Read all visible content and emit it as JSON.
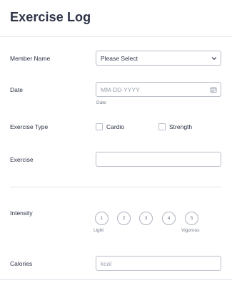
{
  "form": {
    "title": "Exercise Log"
  },
  "fields": {
    "member_name": {
      "label": "Member Name",
      "selected": "Please Select"
    },
    "date": {
      "label": "Date",
      "placeholder": "MM-DD-YYYY",
      "sublabel": "Date"
    },
    "exercise_type": {
      "label": "Exercise Type",
      "options": [
        "Cardio",
        "Strength"
      ]
    },
    "exercise": {
      "label": "Exercise",
      "value": ""
    },
    "intensity": {
      "label": "Intensity",
      "scale": [
        "1",
        "2",
        "3",
        "4",
        "5"
      ],
      "min_label": "Light",
      "max_label": "Vigorous"
    },
    "calories": {
      "label": "Calories",
      "placeholder": "kcal"
    }
  },
  "icons": {
    "select_arrow": "chevron-down-icon",
    "date_picker": "calendar-icon"
  },
  "colors": {
    "text": "#2c3345",
    "border": "#b8bdc9",
    "placeholder": "#9aa0ae",
    "divider": "#dfe2e8"
  }
}
